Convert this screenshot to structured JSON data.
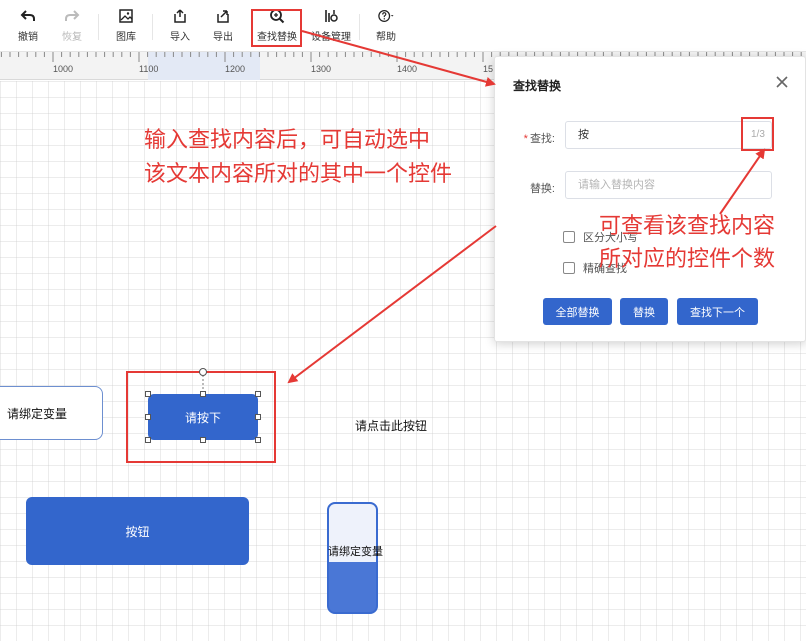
{
  "toolbar": {
    "undo": "撤销",
    "redo": "恢复",
    "gallery": "图库",
    "import": "导入",
    "export": "导出",
    "find_replace": "查找替换",
    "device_manage": "设备管理",
    "help": "帮助"
  },
  "ruler": {
    "ticks": [
      "1000",
      "1100",
      "1200",
      "1300",
      "1400",
      "15"
    ]
  },
  "dialog": {
    "title": "查找替换",
    "close_icon": "close-icon",
    "find_label": "查找:",
    "find_value": "按",
    "match_count": "1/3",
    "replace_label": "替换:",
    "replace_placeholder": "请输入替换内容",
    "case_sensitive": "区分大小写",
    "exact_match": "精确查找",
    "replace_all": "全部替换",
    "replace": "替换",
    "find_next": "查找下一个"
  },
  "canvas": {
    "widget_var": "请绑定变量",
    "widget_selected": "请按下",
    "widget_text": "请点击此按钮",
    "widget_button": "按钮",
    "widget_tank": "请绑定变量"
  },
  "annotations": {
    "left_line1": "输入查找内容后，可自动选中",
    "left_line2": "该文本内容所对的其中一个控件",
    "right_line1": "可查看该查找内容",
    "right_line2": "所对应的控件个数",
    "color": "#e53935"
  },
  "colors": {
    "accent": "#3366cc",
    "annotation": "#e53935"
  }
}
